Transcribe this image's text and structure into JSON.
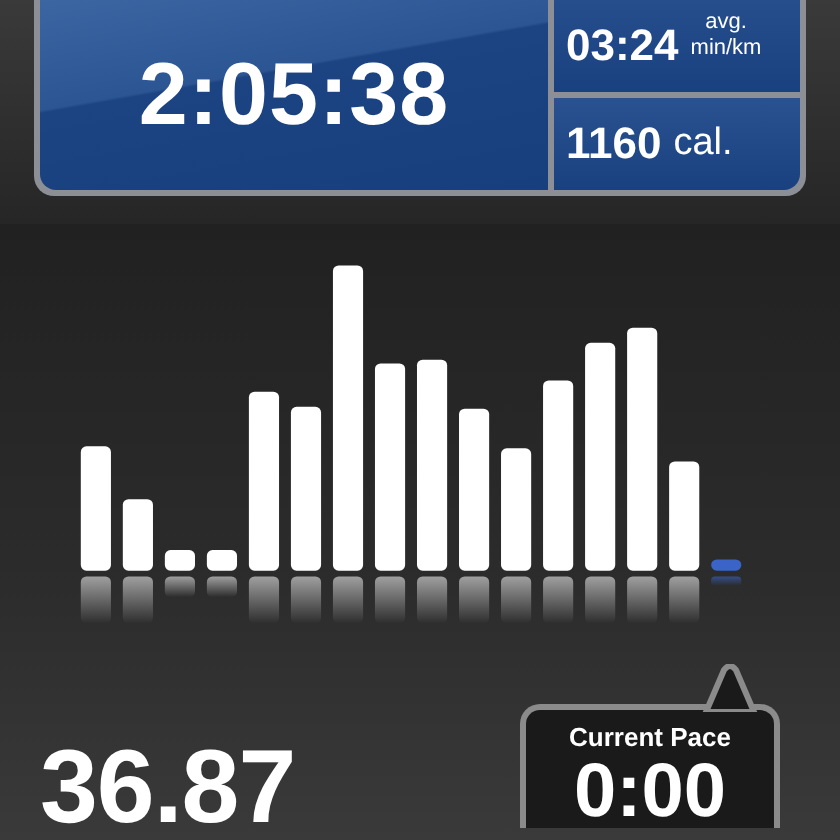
{
  "workout": {
    "duration": "2:05:38",
    "pace": {
      "value": "03:24",
      "label_top": "avg.",
      "label_bottom": "min/km"
    },
    "calories": {
      "value": "1160",
      "unit": "cal."
    }
  },
  "distance": "36.87",
  "current_pace": {
    "label": "Current Pace",
    "value": "0:00"
  }
}
